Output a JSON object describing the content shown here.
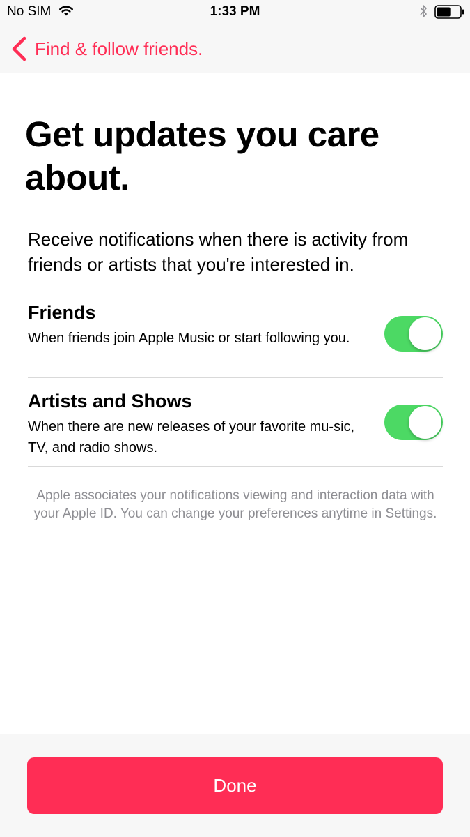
{
  "status_bar": {
    "carrier": "No SIM",
    "time": "1:33 PM",
    "wifi_icon": "wifi-icon",
    "bluetooth_icon": "bluetooth-icon",
    "battery_icon": "battery-icon",
    "battery_level": 0.6
  },
  "nav": {
    "back_label": "Find & follow friends.",
    "back_icon": "chevron-left-icon",
    "accent_color": "#ff2d55"
  },
  "main": {
    "title": "Get updates you care about.",
    "intro": "Receive notifications when there is activity from friends or artists that you're interested in.",
    "settings": [
      {
        "title": "Friends",
        "description": "When friends join Apple Music or start following you.",
        "enabled": true
      },
      {
        "title": "Artists and Shows",
        "description": "When there are new releases of your favorite mu-sic, TV, and radio shows.",
        "enabled": true
      }
    ],
    "footnote": "Apple associates your notifications viewing and interaction data with your Apple ID. You can change your preferences anytime in Settings."
  },
  "footer": {
    "done_label": "Done",
    "button_color": "#ff2d55",
    "toggle_on_color": "#4cd964"
  }
}
